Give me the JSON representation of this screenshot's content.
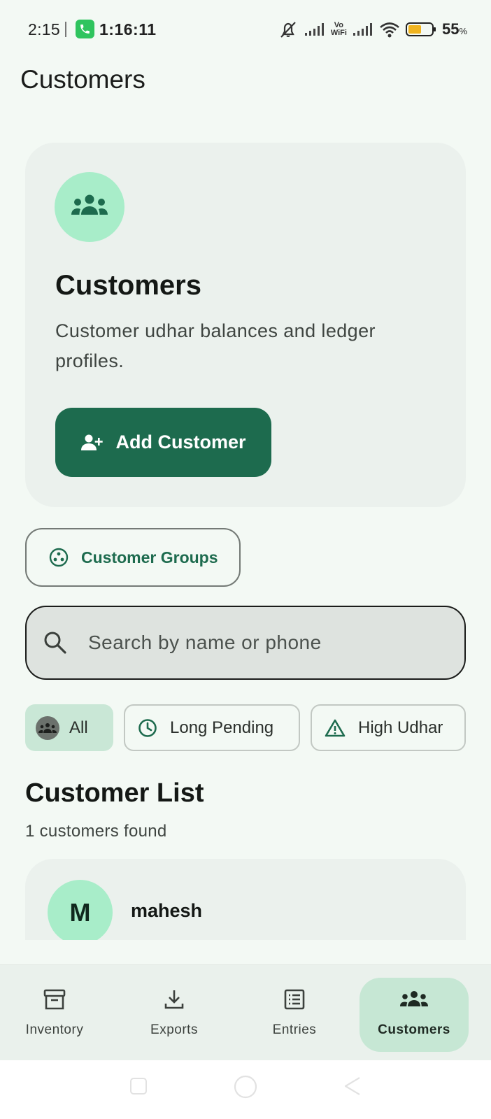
{
  "status_bar": {
    "time": "2:15",
    "call_duration": "1:16:11",
    "vowifi_top": "Vo",
    "vowifi_bottom": "WiFi",
    "battery_percent": "55",
    "battery_unit": "%"
  },
  "page_title": "Customers",
  "hero": {
    "title": "Customers",
    "description": "Customer udhar balances and ledger profiles.",
    "add_button": "Add Customer"
  },
  "groups_button": "Customer Groups",
  "search": {
    "placeholder": "Search by name or phone"
  },
  "filters": [
    {
      "label": "All",
      "selected": true
    },
    {
      "label": "Long Pending",
      "selected": false
    },
    {
      "label": "High Udhar",
      "selected": false
    }
  ],
  "list": {
    "title": "Customer List",
    "count_text": "1 customers found",
    "customers": [
      {
        "initial": "M",
        "name": "mahesh"
      }
    ]
  },
  "bottom_nav": [
    {
      "label": "Inventory",
      "icon": "archive-icon",
      "active": false
    },
    {
      "label": "Exports",
      "icon": "download-icon",
      "active": false
    },
    {
      "label": "Entries",
      "icon": "list-icon",
      "active": false
    },
    {
      "label": "Customers",
      "icon": "groups-icon",
      "active": true
    }
  ],
  "colors": {
    "background": "#f3f9f4",
    "primary": "#1d6b4e",
    "accent_light": "#a8edc9",
    "card": "#ebf1ed",
    "active_nav": "#c6e7d4"
  }
}
